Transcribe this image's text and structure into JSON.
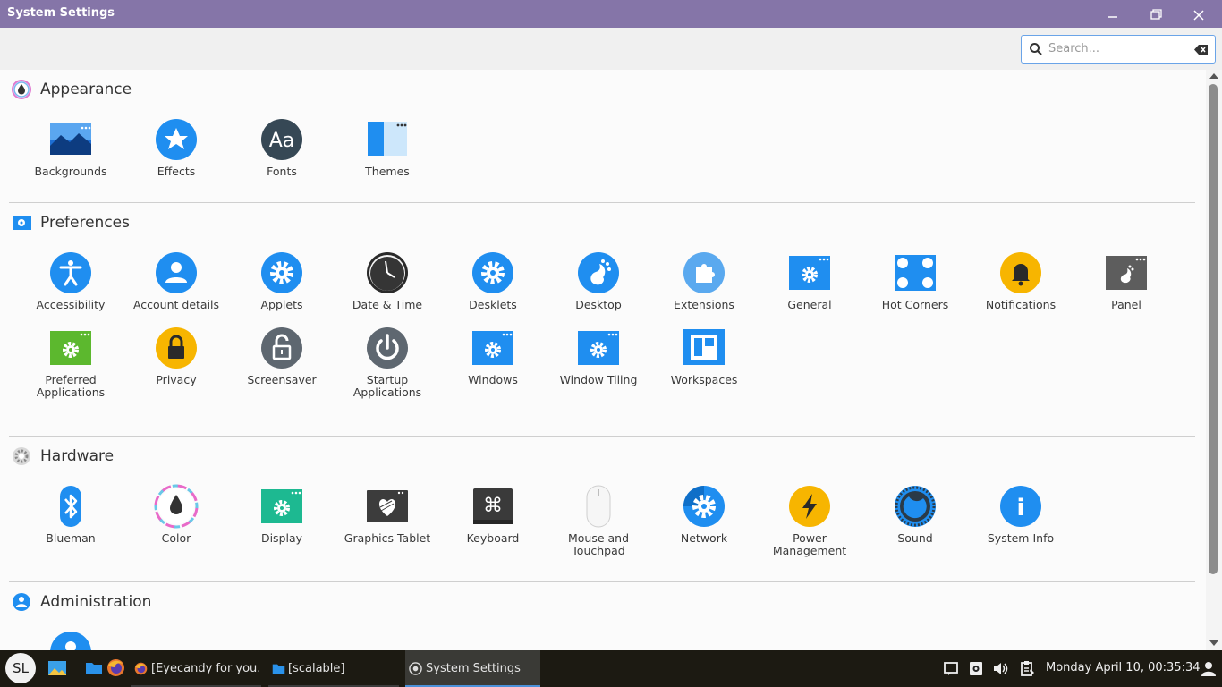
{
  "window": {
    "title": "System Settings",
    "minimize_icon": "minimize-icon",
    "maximize_icon": "restore-icon",
    "close_icon": "close-icon"
  },
  "search": {
    "placeholder": "Search...",
    "value": ""
  },
  "sections": [
    {
      "title": "Appearance",
      "icon": "appearance-icon",
      "items": [
        {
          "label": "Backgrounds",
          "icon": "backgrounds-icon"
        },
        {
          "label": "Effects",
          "icon": "effects-icon"
        },
        {
          "label": "Fonts",
          "icon": "fonts-icon",
          "glyph": "Aa"
        },
        {
          "label": "Themes",
          "icon": "themes-icon"
        }
      ]
    },
    {
      "title": "Preferences",
      "icon": "preferences-icon",
      "items": [
        {
          "label": "Accessibility",
          "icon": "accessibility-icon"
        },
        {
          "label": "Account details",
          "icon": "account-icon"
        },
        {
          "label": "Applets",
          "icon": "applets-icon"
        },
        {
          "label": "Date & Time",
          "icon": "clock-icon"
        },
        {
          "label": "Desklets",
          "icon": "desklets-icon"
        },
        {
          "label": "Desktop",
          "icon": "desktop-icon"
        },
        {
          "label": "Extensions",
          "icon": "extensions-icon"
        },
        {
          "label": "General",
          "icon": "general-icon"
        },
        {
          "label": "Hot Corners",
          "icon": "hot-corners-icon"
        },
        {
          "label": "Notifications",
          "icon": "bell-icon"
        },
        {
          "label": "Panel",
          "icon": "panel-icon"
        },
        {
          "label": "Preferred\nApplications",
          "icon": "preferred-apps-icon"
        },
        {
          "label": "Privacy",
          "icon": "lock-icon"
        },
        {
          "label": "Screensaver",
          "icon": "screensaver-lock-icon"
        },
        {
          "label": "Startup\nApplications",
          "icon": "power-icon"
        },
        {
          "label": "Windows",
          "icon": "windows-icon"
        },
        {
          "label": "Window Tiling",
          "icon": "window-tiling-icon"
        },
        {
          "label": "Workspaces",
          "icon": "workspaces-icon"
        }
      ]
    },
    {
      "title": "Hardware",
      "icon": "hardware-icon",
      "items": [
        {
          "label": "Blueman",
          "icon": "bluetooth-icon"
        },
        {
          "label": "Color",
          "icon": "color-icon"
        },
        {
          "label": "Display",
          "icon": "display-icon"
        },
        {
          "label": "Graphics Tablet",
          "icon": "tablet-icon"
        },
        {
          "label": "Keyboard",
          "icon": "keyboard-icon",
          "glyph": "⌘"
        },
        {
          "label": "Mouse and\nTouchpad",
          "icon": "mouse-icon"
        },
        {
          "label": "Network",
          "icon": "network-icon"
        },
        {
          "label": "Power\nManagement",
          "icon": "power-management-icon"
        },
        {
          "label": "Sound",
          "icon": "sound-icon"
        },
        {
          "label": "System Info",
          "icon": "info-icon",
          "glyph": "i"
        }
      ]
    },
    {
      "title": "Administration",
      "icon": "administration-icon",
      "items": [
        {
          "label": "",
          "icon": "users-icon"
        }
      ]
    }
  ],
  "taskbar": {
    "menu_label": "SL",
    "launchers": [
      "image-viewer-icon",
      "files-icon",
      "firefox-icon"
    ],
    "tasks": [
      {
        "label": "[Eyecandy for you...",
        "icon": "firefox-icon"
      },
      {
        "label": "[scalable]",
        "icon": "folder-icon"
      },
      {
        "label": "System Settings",
        "icon": "settings-icon"
      }
    ],
    "tray": [
      "notes-icon",
      "update-icon",
      "volume-icon",
      "clipboard-icon",
      "user-icon"
    ],
    "clock": "Monday April 10, 00:35:34"
  },
  "colors": {
    "titlebar": "#8575a8",
    "accent_blue": "#2b9af3",
    "taskbar": "#1c1a12"
  }
}
